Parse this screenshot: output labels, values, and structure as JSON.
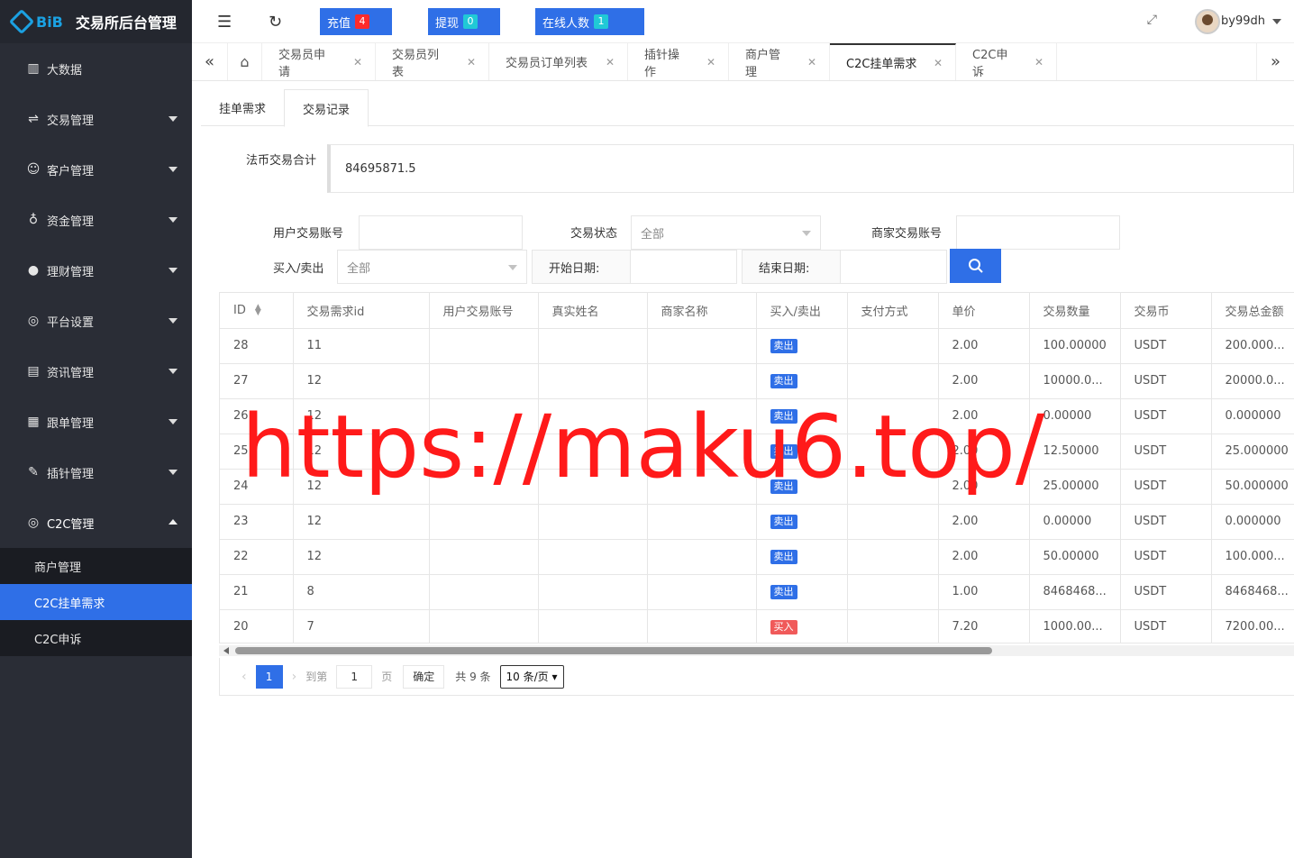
{
  "brand": {
    "logo_text": "BiB",
    "title": "交易所后台管理"
  },
  "colors": {
    "primary": "#2f6fe7",
    "sidebar_bg": "#2a2d36",
    "badge_red": "#ff2b2b",
    "badge_cyan": "#20c9d6",
    "tag_sell": "#2f6fe7",
    "tag_buy": "#f05a5a",
    "watermark": "#ff1a1a"
  },
  "sidebar": {
    "items": [
      {
        "label": "大数据",
        "icon": "bar-chart-icon"
      },
      {
        "label": "交易管理",
        "icon": "exchange-icon"
      },
      {
        "label": "客户管理",
        "icon": "users-icon"
      },
      {
        "label": "资金管理",
        "icon": "money-bag-icon"
      },
      {
        "label": "理财管理",
        "icon": "piggy-bank-icon"
      },
      {
        "label": "平台设置",
        "icon": "settings-circle-icon"
      },
      {
        "label": "资讯管理",
        "icon": "news-icon"
      },
      {
        "label": "跟单管理",
        "icon": "document-icon"
      },
      {
        "label": "插针管理",
        "icon": "pin-icon"
      },
      {
        "label": "C2C管理",
        "icon": "c2c-icon"
      }
    ],
    "submenu": [
      {
        "label": "商户管理"
      },
      {
        "label": "C2C挂单需求"
      },
      {
        "label": "C2C申诉"
      }
    ]
  },
  "header": {
    "recharge_label": "充值",
    "recharge_count": "4",
    "withdraw_label": "提现",
    "withdraw_count": "0",
    "online_label": "在线人数",
    "online_count": "1",
    "username": "by99dh"
  },
  "tabs": [
    {
      "label": "交易员申请"
    },
    {
      "label": "交易员列表"
    },
    {
      "label": "交易员订单列表"
    },
    {
      "label": "插针操作"
    },
    {
      "label": "商户管理"
    },
    {
      "label": "C2C挂单需求"
    },
    {
      "label": "C2C申诉"
    }
  ],
  "subtabs": [
    {
      "label": "挂单需求"
    },
    {
      "label": "交易记录"
    }
  ],
  "summary": {
    "label": "法币交易合计",
    "value": "84695871.5"
  },
  "filters": {
    "user_account_label": "用户交易账号",
    "status_label": "交易状态",
    "status_value": "全部",
    "merchant_account_label": "商家交易账号",
    "direction_label": "买入/卖出",
    "direction_value": "全部",
    "start_date_label": "开始日期:",
    "end_date_label": "结束日期:"
  },
  "table": {
    "columns": [
      "ID",
      "交易需求id",
      "用户交易账号",
      "真实姓名",
      "商家名称",
      "买入/卖出",
      "支付方式",
      "单价",
      "交易数量",
      "交易币",
      "交易总金额"
    ],
    "rows": [
      {
        "id": "28",
        "req": "11",
        "side": "卖出",
        "side_type": "sell",
        "price": "2.00",
        "qty": "100.00000",
        "coin": "USDT",
        "total": "200.000..."
      },
      {
        "id": "27",
        "req": "12",
        "side": "卖出",
        "side_type": "sell",
        "price": "2.00",
        "qty": "10000.0...",
        "coin": "USDT",
        "total": "20000.0..."
      },
      {
        "id": "26",
        "req": "12",
        "side": "卖出",
        "side_type": "sell",
        "price": "2.00",
        "qty": "0.00000",
        "coin": "USDT",
        "total": "0.000000"
      },
      {
        "id": "25",
        "req": "12",
        "side": "卖出",
        "side_type": "sell",
        "price": "2.00",
        "qty": "12.50000",
        "coin": "USDT",
        "total": "25.000000"
      },
      {
        "id": "24",
        "req": "12",
        "side": "卖出",
        "side_type": "sell",
        "price": "2.00",
        "qty": "25.00000",
        "coin": "USDT",
        "total": "50.000000"
      },
      {
        "id": "23",
        "req": "12",
        "side": "卖出",
        "side_type": "sell",
        "price": "2.00",
        "qty": "0.00000",
        "coin": "USDT",
        "total": "0.000000"
      },
      {
        "id": "22",
        "req": "12",
        "side": "卖出",
        "side_type": "sell",
        "price": "2.00",
        "qty": "50.00000",
        "coin": "USDT",
        "total": "100.000..."
      },
      {
        "id": "21",
        "req": "8",
        "side": "卖出",
        "side_type": "sell",
        "price": "1.00",
        "qty": "8468468...",
        "coin": "USDT",
        "total": "8468468..."
      },
      {
        "id": "20",
        "req": "7",
        "side": "买入",
        "side_type": "buy",
        "price": "7.20",
        "qty": "1000.00...",
        "coin": "USDT",
        "total": "7200.00..."
      }
    ]
  },
  "pager": {
    "current_page": "1",
    "goto_label": "到第",
    "goto_value": "1",
    "page_unit": "页",
    "confirm_label": "确定",
    "total_label": "共 9 条",
    "page_size": "10 条/页"
  },
  "watermark": "https://maku6.top/"
}
